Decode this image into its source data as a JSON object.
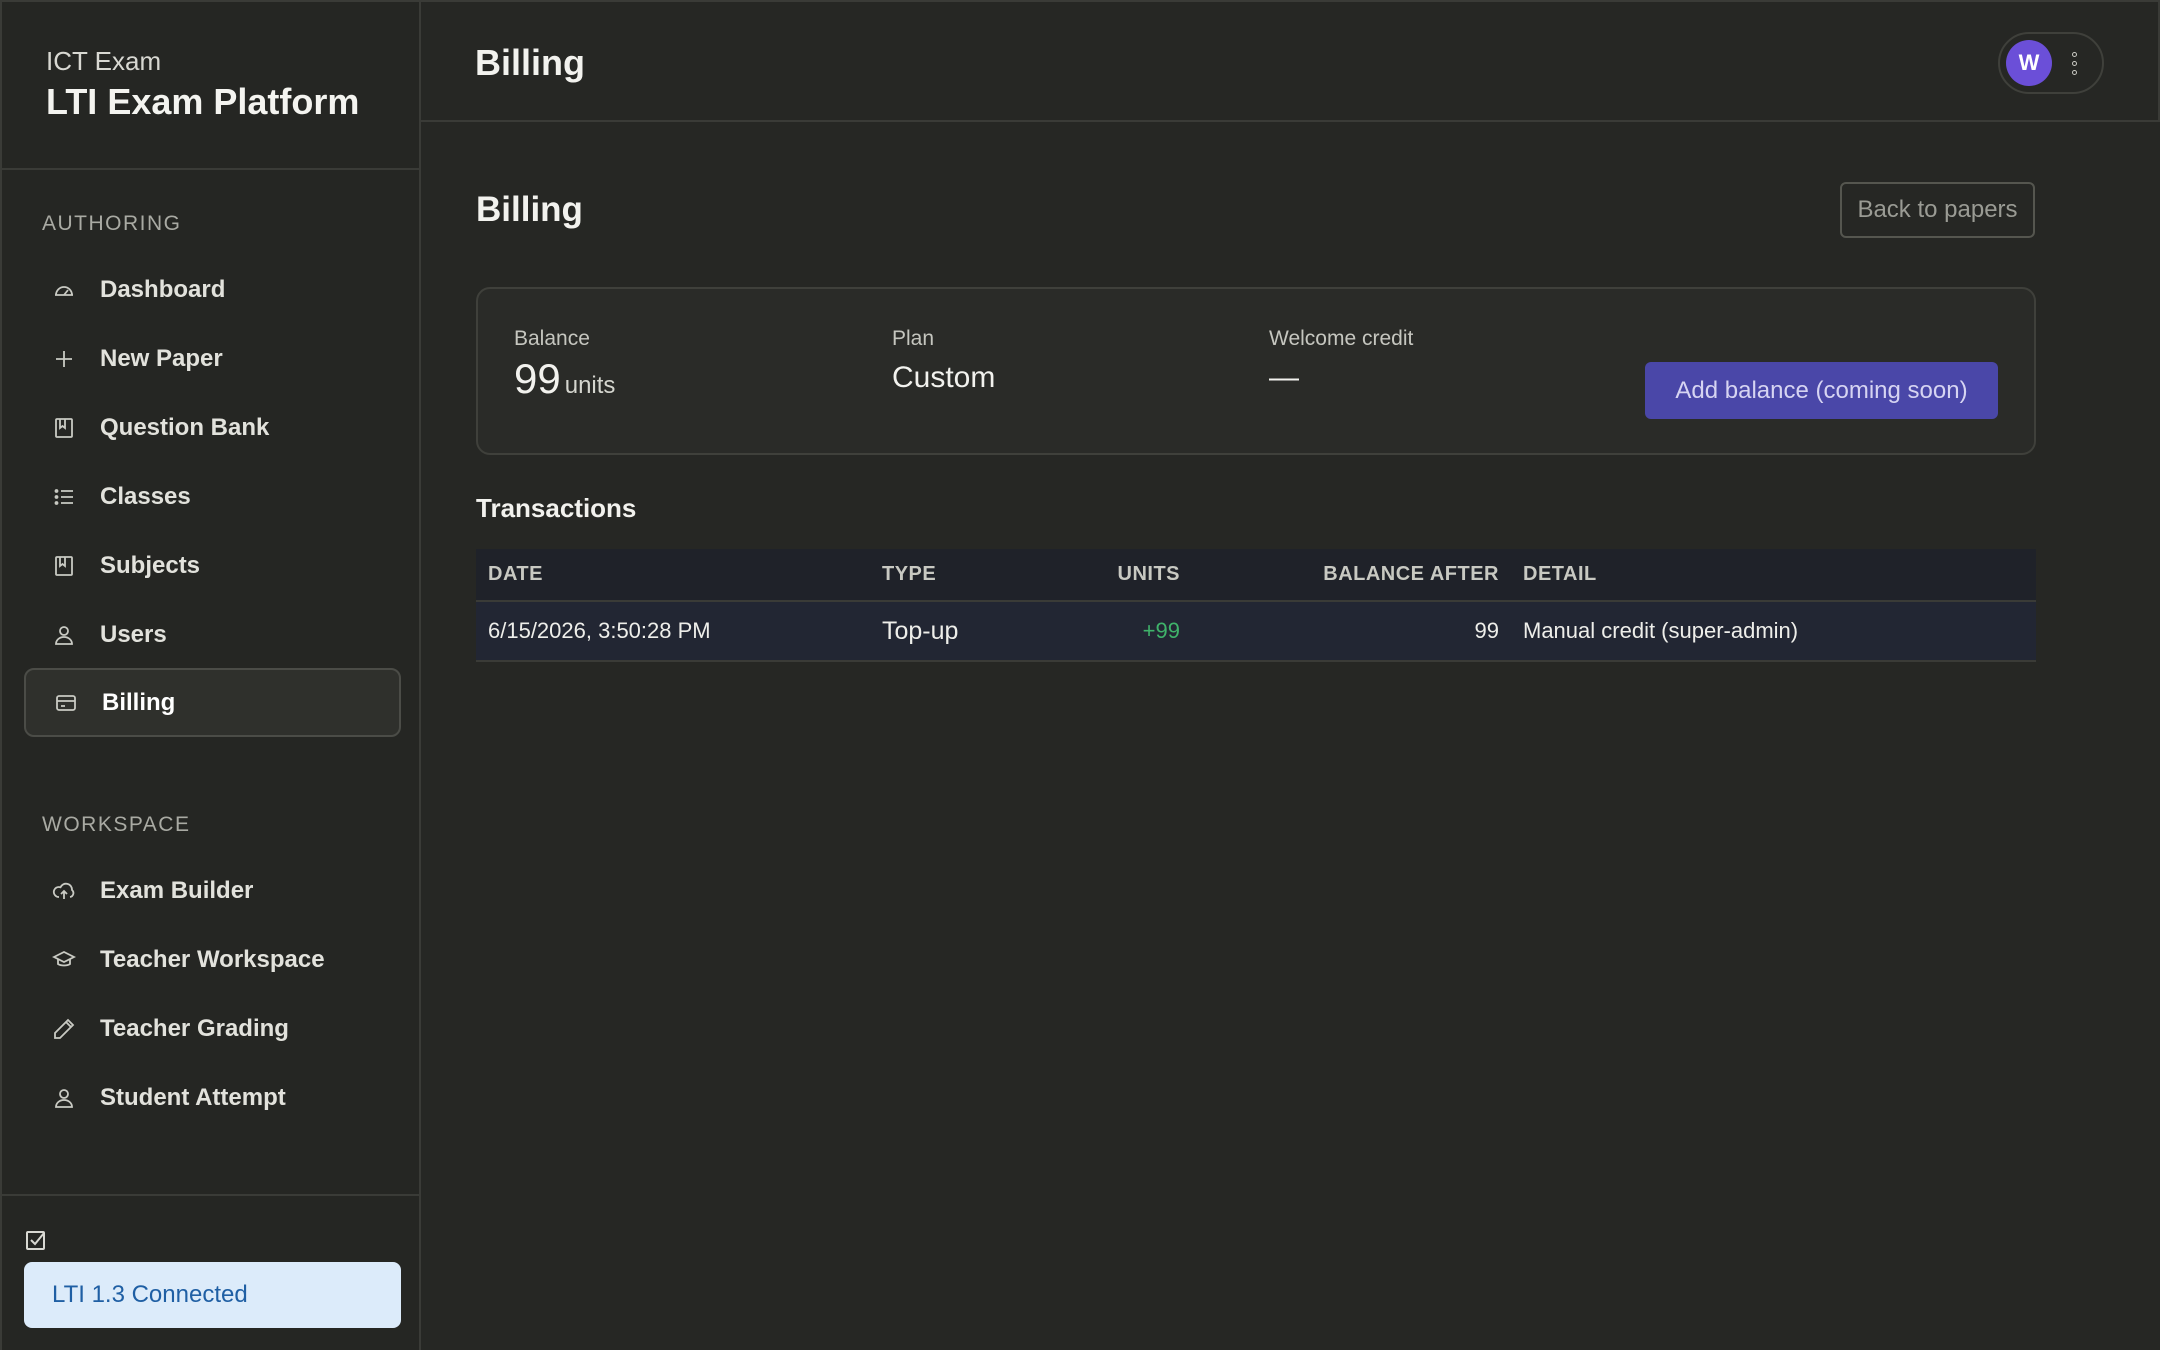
{
  "brand": {
    "subtitle": "ICT Exam",
    "title": "LTI Exam Platform"
  },
  "sidebar": {
    "authoring_label": "AUTHORING",
    "authoring_items": [
      {
        "label": "Dashboard",
        "icon": "gauge-icon"
      },
      {
        "label": "New Paper",
        "icon": "plus-icon"
      },
      {
        "label": "Question Bank",
        "icon": "book-icon"
      },
      {
        "label": "Classes",
        "icon": "list-icon"
      },
      {
        "label": "Subjects",
        "icon": "book-icon"
      },
      {
        "label": "Users",
        "icon": "user-icon"
      },
      {
        "label": "Billing",
        "icon": "credit-card-icon",
        "active": true
      }
    ],
    "workspace_label": "WORKSPACE",
    "workspace_items": [
      {
        "label": "Exam Builder",
        "icon": "cloud-upload-icon"
      },
      {
        "label": "Teacher Workspace",
        "icon": "graduation-cap-icon"
      },
      {
        "label": "Teacher Grading",
        "icon": "pencil-icon"
      },
      {
        "label": "Student Attempt",
        "icon": "user-icon"
      }
    ],
    "footer": {
      "icon": "checkbox-icon",
      "status": "LTI 1.3 Connected"
    }
  },
  "topbar": {
    "title": "Billing",
    "avatar_initial": "W"
  },
  "main": {
    "heading": "Billing",
    "back_button": "Back to papers",
    "summary": {
      "balance_label": "Balance",
      "balance_value": "99",
      "balance_unit": "units",
      "plan_label": "Plan",
      "plan_value": "Custom",
      "welcome_label": "Welcome credit",
      "welcome_value": "—",
      "add_button": "Add balance (coming soon)"
    },
    "transactions": {
      "heading": "Transactions",
      "columns": [
        "DATE",
        "TYPE",
        "UNITS",
        "BALANCE AFTER",
        "DETAIL"
      ],
      "rows": [
        {
          "date": "6/15/2026, 3:50:28 PM",
          "type": "Top-up",
          "units": "+99",
          "balance_after": "99",
          "detail": "Manual credit (super-admin)"
        }
      ]
    }
  },
  "colors": {
    "background": "#262724",
    "accent_button": "#4a47a8",
    "avatar": "#6b4fd8",
    "positive_units": "#3fb26a",
    "lti_badge_bg": "#dcebfa",
    "lti_badge_text": "#1f5fa4"
  }
}
